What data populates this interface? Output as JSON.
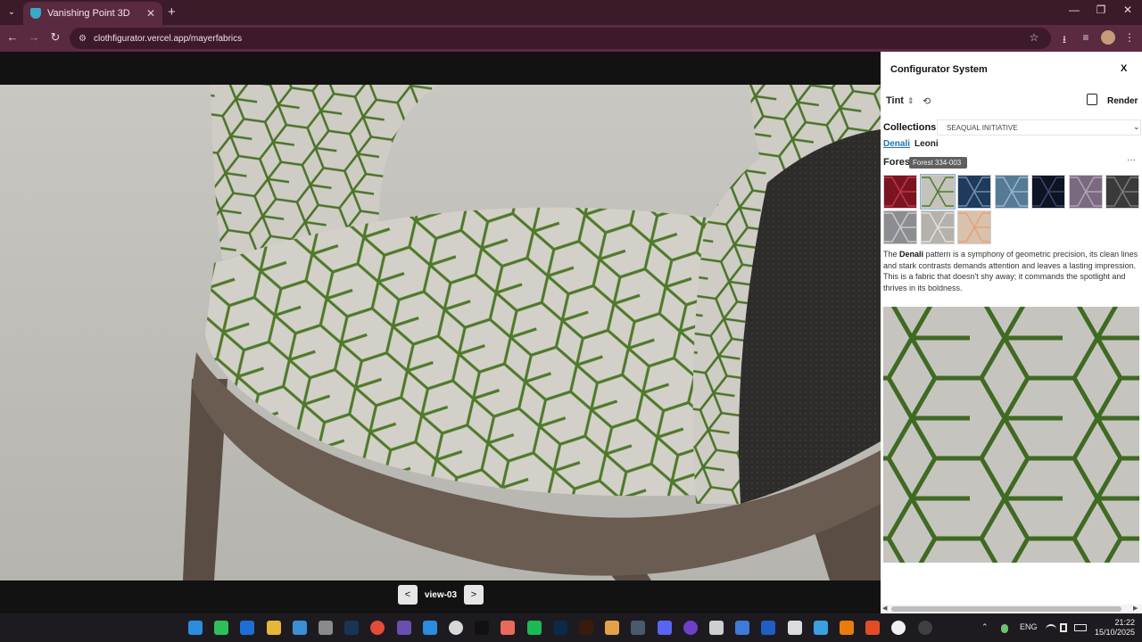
{
  "browser": {
    "tab_title": "Vanishing Point 3D",
    "tab_close": "✕",
    "new_tab": "+",
    "tab_dropdown": "⌄",
    "url": "clothfigurator.vercel.app/mayerfabrics",
    "nav_back": "←",
    "nav_forward": "→",
    "nav_reload": "↻",
    "window_minimize": "—",
    "window_restore": "❐",
    "window_close": "✕",
    "bookmark": "☆",
    "download": "⭳",
    "menu": "⋮",
    "media": "≡",
    "site_info": "⚙"
  },
  "viewer": {
    "prev_label": "<",
    "next_label": ">",
    "view_label": "view-03"
  },
  "panel": {
    "title": "Configurator System",
    "close_label": "X",
    "tint_label": "Tint",
    "tint_sort": "⇕",
    "tint_reset": "⟲",
    "render_label": "Render",
    "collections_label": "Collections",
    "collection_value": "SEAQUAL INITIATIVE",
    "collection_chevron": "⌄",
    "patterns": [
      "Denali",
      "Leoni"
    ],
    "colorway_name": "Forest",
    "tooltip": "Forest 334-003",
    "more_label": "···",
    "swatches": [
      {
        "name": "swatch-red",
        "color": "#7a1420",
        "line": "#c2354a"
      },
      {
        "name": "swatch-forest",
        "color": "#c3c2bb",
        "line": "#4f7a2c"
      },
      {
        "name": "swatch-navy",
        "color": "#1f3a5c",
        "line": "#6f8fb0"
      },
      {
        "name": "swatch-slate-blue",
        "color": "#557a96",
        "line": "#9ab6c8"
      },
      {
        "name": "swatch-midnight",
        "color": "#0d1424",
        "line": "#3a4a66"
      },
      {
        "name": "swatch-lilac",
        "color": "#7a6a80",
        "line": "#b2a4b8"
      },
      {
        "name": "swatch-charcoal",
        "color": "#3a3a3a",
        "line": "#7a7a7a"
      },
      {
        "name": "swatch-grey",
        "color": "#8c8d90",
        "line": "#c8c8ca"
      },
      {
        "name": "swatch-stone",
        "color": "#b5b2ad",
        "line": "#e2dfd9"
      },
      {
        "name": "swatch-peach",
        "color": "#d8c2ae",
        "line": "#e9a07a"
      }
    ],
    "description_pre": "The ",
    "description_bold": "Denali",
    "description_post": " pattern is a symphony of geometric precision, its clean lines and stark contrasts demands attention and leaves a lasting impression. This is a fabric that doesn't shy away; it commands the spotlight and thrives in its boldness.",
    "scroll_left": "◀",
    "scroll_right": "▶"
  },
  "taskbar": {
    "apps": [
      {
        "name": "windows-start-icon",
        "color": "#2b8de0"
      },
      {
        "name": "whatsapp-icon",
        "color": "#2fbf5a"
      },
      {
        "name": "outlook-icon",
        "color": "#1d6fd6"
      },
      {
        "name": "file-explorer-icon",
        "color": "#e7b73a"
      },
      {
        "name": "notepad-icon",
        "color": "#3a8fd6"
      },
      {
        "name": "printer-icon",
        "color": "#8a8a8a"
      },
      {
        "name": "steam-icon",
        "color": "#1a3553"
      },
      {
        "name": "chrome-icon",
        "color": "#e44b3a"
      },
      {
        "name": "vs-icon",
        "color": "#6a4fb0"
      },
      {
        "name": "vscode-icon",
        "color": "#2a8ce0"
      },
      {
        "name": "circle-app-icon",
        "color": "#d8d8d8"
      },
      {
        "name": "capcut-icon",
        "color": "#111111"
      },
      {
        "name": "krita-icon",
        "color": "#e86a5a"
      },
      {
        "name": "spotify-icon",
        "color": "#1db954"
      },
      {
        "name": "photoshop-icon",
        "color": "#0b2a4a"
      },
      {
        "name": "illustrator-icon",
        "color": "#3a1a0a"
      },
      {
        "name": "globe-app-icon",
        "color": "#e3a24a"
      },
      {
        "name": "davinci-icon",
        "color": "#4a5a6a"
      },
      {
        "name": "discord-icon",
        "color": "#5865f2"
      },
      {
        "name": "github-icon",
        "color": "#6e40c9"
      },
      {
        "name": "unity-icon",
        "color": "#cfcfcf"
      },
      {
        "name": "bootstrap-icon",
        "color": "#3e7bd8"
      },
      {
        "name": "cura-icon",
        "color": "#1f5fc4"
      },
      {
        "name": "codex-icon",
        "color": "#dcdcdc"
      },
      {
        "name": "azure-icon",
        "color": "#3aa0e0"
      },
      {
        "name": "blender-icon",
        "color": "#e87d0d"
      },
      {
        "name": "html-icon",
        "color": "#e34c26"
      },
      {
        "name": "unreal-icon",
        "color": "#f0f0f0"
      },
      {
        "name": "obs-icon",
        "color": "#404040"
      }
    ],
    "tray_chevron": "⌃",
    "lang": "ENG",
    "time": "21:22",
    "date": "15/10/2025"
  }
}
